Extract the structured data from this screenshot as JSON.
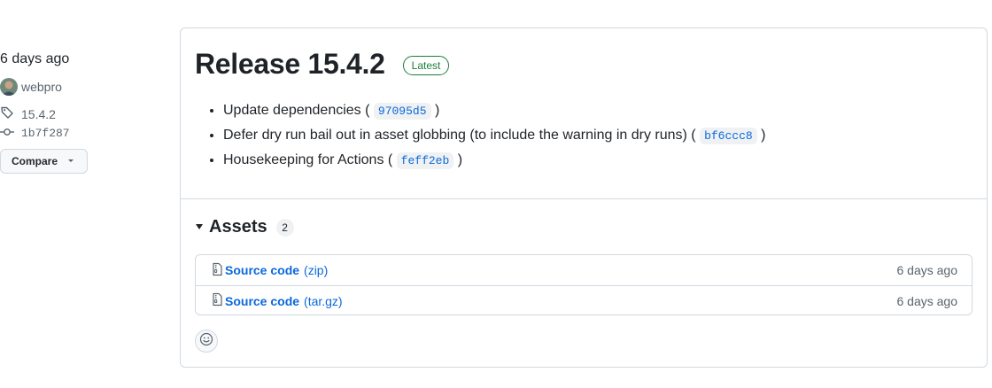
{
  "sidebar": {
    "date": "6 days ago",
    "author": "webpro",
    "tag": "15.4.2",
    "commit": "1b7f287",
    "compare_label": "Compare"
  },
  "release": {
    "title": "Release 15.4.2",
    "badge": "Latest",
    "notes": [
      {
        "text": "Update dependencies (",
        "sha": "97095d5",
        "close": ")"
      },
      {
        "text": "Defer dry run bail out in asset globbing (to include the warning in dry runs) (",
        "sha": "bf6ccc8",
        "close": ")"
      },
      {
        "text": "Housekeeping for Actions (",
        "sha": "feff2eb",
        "close": ")"
      }
    ]
  },
  "assets": {
    "title": "Assets",
    "count": "2",
    "items": [
      {
        "name": "Source code",
        "ext": "(zip)",
        "date": "6 days ago"
      },
      {
        "name": "Source code",
        "ext": "(tar.gz)",
        "date": "6 days ago"
      }
    ]
  },
  "colors": {
    "link": "#0969da",
    "latest": "#1a7f37",
    "border": "#d1d9e0"
  },
  "icons": [
    "tag-icon",
    "git-commit-icon",
    "triangle-down-icon",
    "file-zip-icon",
    "smiley-icon"
  ]
}
